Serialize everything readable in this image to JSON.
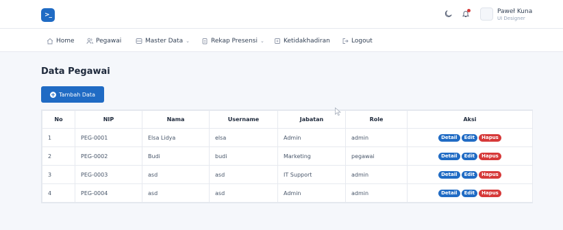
{
  "header": {
    "logo_glyph": ">_",
    "user_name": "Paweł Kuna",
    "user_role": "UI Designer",
    "icons": [
      "moon-icon",
      "bell-icon"
    ]
  },
  "nav": {
    "items": [
      {
        "label": "Home",
        "icon": "home-icon",
        "dropdown": false
      },
      {
        "label": "Pegawai",
        "icon": "users-icon",
        "dropdown": false
      },
      {
        "label": "Master Data",
        "icon": "database-icon",
        "dropdown": true
      },
      {
        "label": "Rekap Presensi",
        "icon": "clipboard-icon",
        "dropdown": true
      },
      {
        "label": "Ketidakhadiran",
        "icon": "document-icon",
        "dropdown": false
      },
      {
        "label": "Logout",
        "icon": "logout-icon",
        "dropdown": false
      }
    ]
  },
  "page": {
    "title": "Data Pegawai",
    "add_button": "Tambah Data"
  },
  "table": {
    "columns": [
      "No",
      "NIP",
      "Nama",
      "Username",
      "Jabatan",
      "Role",
      "Aksi"
    ],
    "rows": [
      {
        "no": "1",
        "nip": "PEG-0001",
        "nama": "Elsa Lidya",
        "username": "elsa",
        "jabatan": "Admin",
        "role": "admin"
      },
      {
        "no": "2",
        "nip": "PEG-0002",
        "nama": "Budi",
        "username": "budi",
        "jabatan": "Marketing",
        "role": "pegawai"
      },
      {
        "no": "3",
        "nip": "PEG-0003",
        "nama": "asd",
        "username": "asd",
        "jabatan": "IT Support",
        "role": "admin"
      },
      {
        "no": "4",
        "nip": "PEG-0004",
        "nama": "asd",
        "username": "asd",
        "jabatan": "Admin",
        "role": "admin"
      }
    ],
    "actions": {
      "detail": "Detail",
      "edit": "Edit",
      "hapus": "Hapus"
    }
  },
  "colors": {
    "primary": "#206bc4",
    "danger": "#d63939",
    "background": "#f5f7fb"
  }
}
